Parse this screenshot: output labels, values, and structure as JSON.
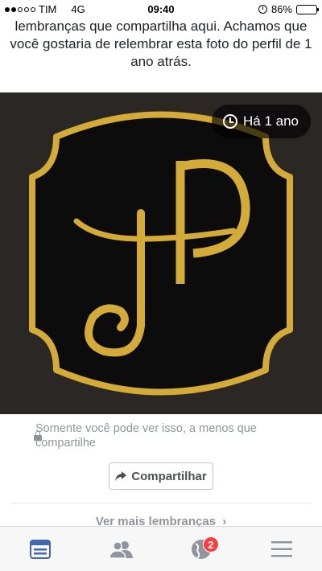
{
  "status_bar": {
    "carrier": "TIM",
    "network": "4G",
    "time": "09:40",
    "battery": "86%",
    "battery_level": 0.86
  },
  "intro_text": "lembranças que compartilha aqui. Achamos que você gostaria de relembrar esta foto do perfil de 1 ano atrás.",
  "photo": {
    "time_badge": "Há 1 ano",
    "colors": {
      "background": "#2b2725",
      "gold": "#d4ab37",
      "frame_fill": "#0c0c0c"
    }
  },
  "privacy_note": "Somente você pode ver isso, a menos que compartilhe",
  "share_button": "Compartilhar",
  "see_more": "Ver mais lembranças",
  "tab_bar": {
    "tabs": [
      {
        "name": "news-feed",
        "icon": "news-feed-icon",
        "active": true
      },
      {
        "name": "friends",
        "icon": "friends-icon",
        "active": false
      },
      {
        "name": "notifications",
        "icon": "globe-icon",
        "active": false,
        "badge": "2"
      },
      {
        "name": "menu",
        "icon": "menu-icon",
        "active": false
      }
    ],
    "active_color": "#4267b2",
    "inactive_color": "#90949c"
  }
}
